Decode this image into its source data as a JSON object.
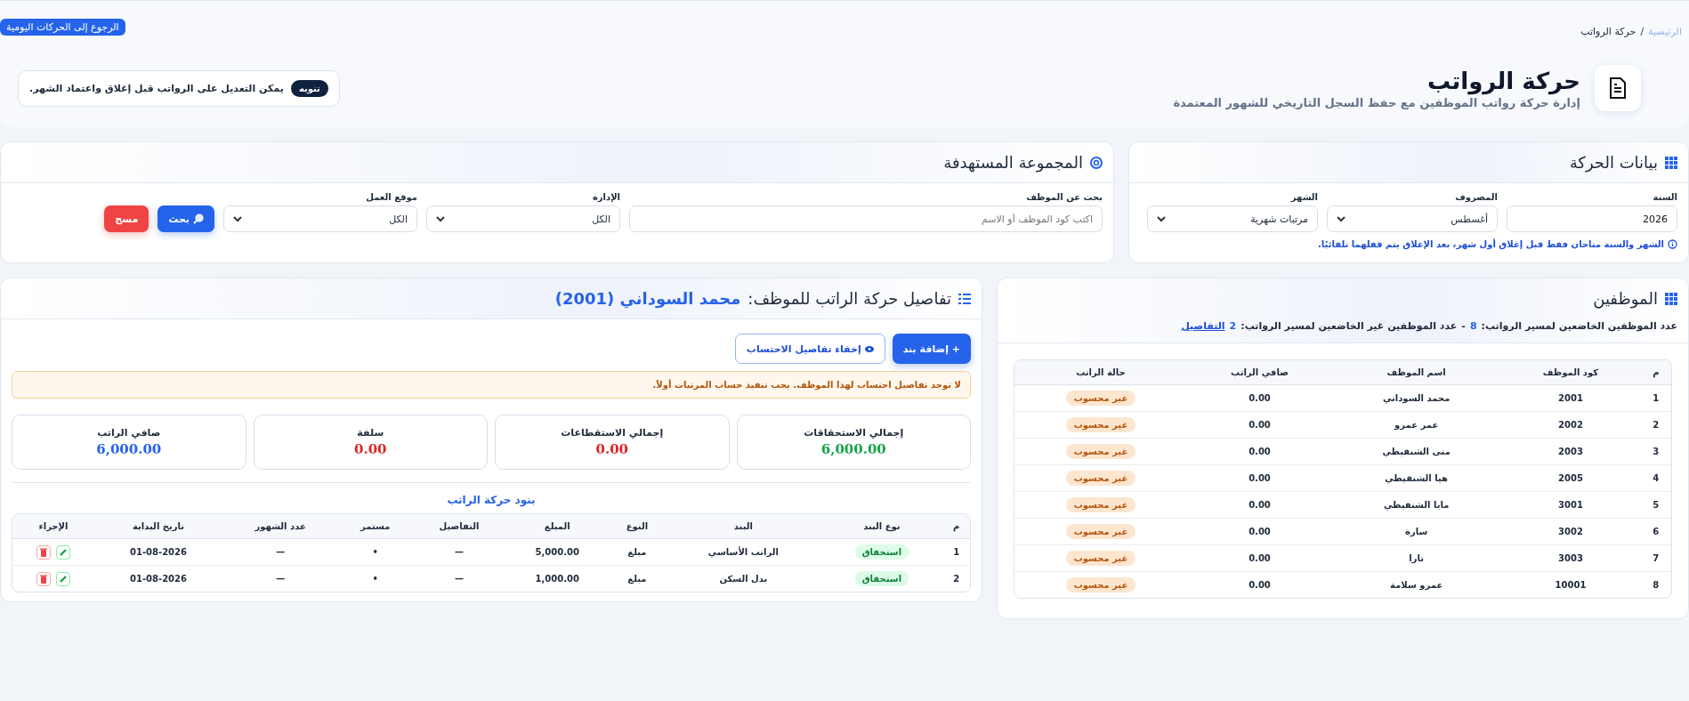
{
  "breadcrumb": {
    "items": [
      {
        "label": "الرئيسية",
        "kind": "link"
      },
      {
        "label": "حركة الرواتب",
        "kind": "current"
      }
    ],
    "separator": "/"
  },
  "back_button": "الرجوع إلى الحركات اليومية",
  "header": {
    "title": "حركة الرواتب",
    "subtitle": "إدارة حركة رواتب الموظفين مع حفظ السجل التاريخي للشهور المعتمدة",
    "notice": {
      "badge": "تنويه",
      "text": "يمكن التعديل على الرواتب قبل إغلاق واعتماد الشهر."
    }
  },
  "movement_data": {
    "title": "بيانات الحركة",
    "fields": [
      {
        "label": "السنة",
        "kind": "input",
        "value": "2026"
      },
      {
        "label": "المصروف",
        "kind": "select",
        "value": "أغسطس"
      },
      {
        "label": "الشهر",
        "kind": "select",
        "value": "مرتبات شهرية"
      }
    ],
    "hint": "الشهر والسنة متاحان فقط قبل إغلاق أول شهر، بعد الإغلاق يتم قفلهما تلقائيًا."
  },
  "target_group": {
    "title": "المجموعة المستهدفة",
    "fields": [
      {
        "label": "بحث عن الموظف",
        "kind": "input",
        "placeholder": "اكتب كود الموظف أو الاسم"
      },
      {
        "label": "الإدارة",
        "kind": "select",
        "value": "الكل"
      },
      {
        "label": "موقع العمل",
        "kind": "select",
        "value": "الكل"
      }
    ],
    "buttons": [
      {
        "label": "بحث",
        "kind": "primary"
      },
      {
        "label": "مسح",
        "kind": "danger"
      }
    ]
  },
  "employees": {
    "title": "الموظفين",
    "summary": {
      "subject_label": "عدد الموظفين الخاضعين لمسير الرواتب:",
      "subject_count": "8",
      "separator": "-",
      "nonsubject_label": "عدد الموظفين غير الخاضعين لمسير الرواتب:",
      "nonsubject_count": "2",
      "details_link": "التفاصيل"
    },
    "columns": [
      "م",
      "كود الموظف",
      "اسم الموظف",
      "صافي الراتب",
      "حالة الراتب"
    ],
    "rows": [
      {
        "no": "1",
        "code": "2001",
        "name": "محمد السوداني",
        "net": "0.00",
        "status": "غير محسوب"
      },
      {
        "no": "2",
        "code": "2002",
        "name": "عمر عمرو",
        "net": "0.00",
        "status": "غير محسوب"
      },
      {
        "no": "3",
        "code": "2003",
        "name": "منى الشنقيطي",
        "net": "0.00",
        "status": "غير محسوب"
      },
      {
        "no": "4",
        "code": "2005",
        "name": "هيا الشنقيطي",
        "net": "0.00",
        "status": "غير محسوب"
      },
      {
        "no": "5",
        "code": "3001",
        "name": "مايا الشنقيطي",
        "net": "0.00",
        "status": "غير محسوب"
      },
      {
        "no": "6",
        "code": "3002",
        "name": "سارة",
        "net": "0.00",
        "status": "غير محسوب"
      },
      {
        "no": "7",
        "code": "3003",
        "name": "تارا",
        "net": "0.00",
        "status": "غير محسوب"
      },
      {
        "no": "8",
        "code": "10001",
        "name": "عمرو سلامة",
        "net": "0.00",
        "status": "غير محسوب"
      }
    ]
  },
  "details": {
    "title": "تفاصيل حركة الراتب للموظف:",
    "employee": "محمد السوداني (2001)",
    "buttons": [
      {
        "label": "+ إضافة بند",
        "kind": "primary"
      },
      {
        "label": "إخفاء تفاصيل الاحتساب",
        "kind": "outline"
      }
    ],
    "warning": "لا توجد تفاصيل احتساب لهذا الموظف. يجب تنفيذ حساب المرتبات أولاً.",
    "totals": [
      {
        "label": "إجمالي الاستحقاقات",
        "value": "6,000.00",
        "color": "#16a34a"
      },
      {
        "label": "إجمالي الاستقطاعات",
        "value": "0.00",
        "color": "#dc2626"
      },
      {
        "label": "سلفة",
        "value": "0.00",
        "color": "#dc2626"
      },
      {
        "label": "صافي الراتب",
        "value": "6,000.00",
        "color": "#2563eb"
      }
    ],
    "items_title": "بنود حركة الراتب",
    "items_columns": [
      "م",
      "نوع البند",
      "البند",
      "النوع",
      "المبلغ",
      "التفاصيل",
      "مستمر",
      "عدد الشهور",
      "تاريخ البداية",
      "الإجراء"
    ],
    "items": [
      {
        "no": "1",
        "type": "استحقاق",
        "name": "الراتب الأساسي",
        "kind": "مبلغ",
        "amount": "5,000.00",
        "details": "—",
        "continuous": "•",
        "months": "—",
        "start": "01-08-2026"
      },
      {
        "no": "2",
        "type": "استحقاق",
        "name": "بدل السكن",
        "kind": "مبلغ",
        "amount": "1,000.00",
        "details": "—",
        "continuous": "•",
        "months": "—",
        "start": "01-08-2026"
      }
    ]
  }
}
